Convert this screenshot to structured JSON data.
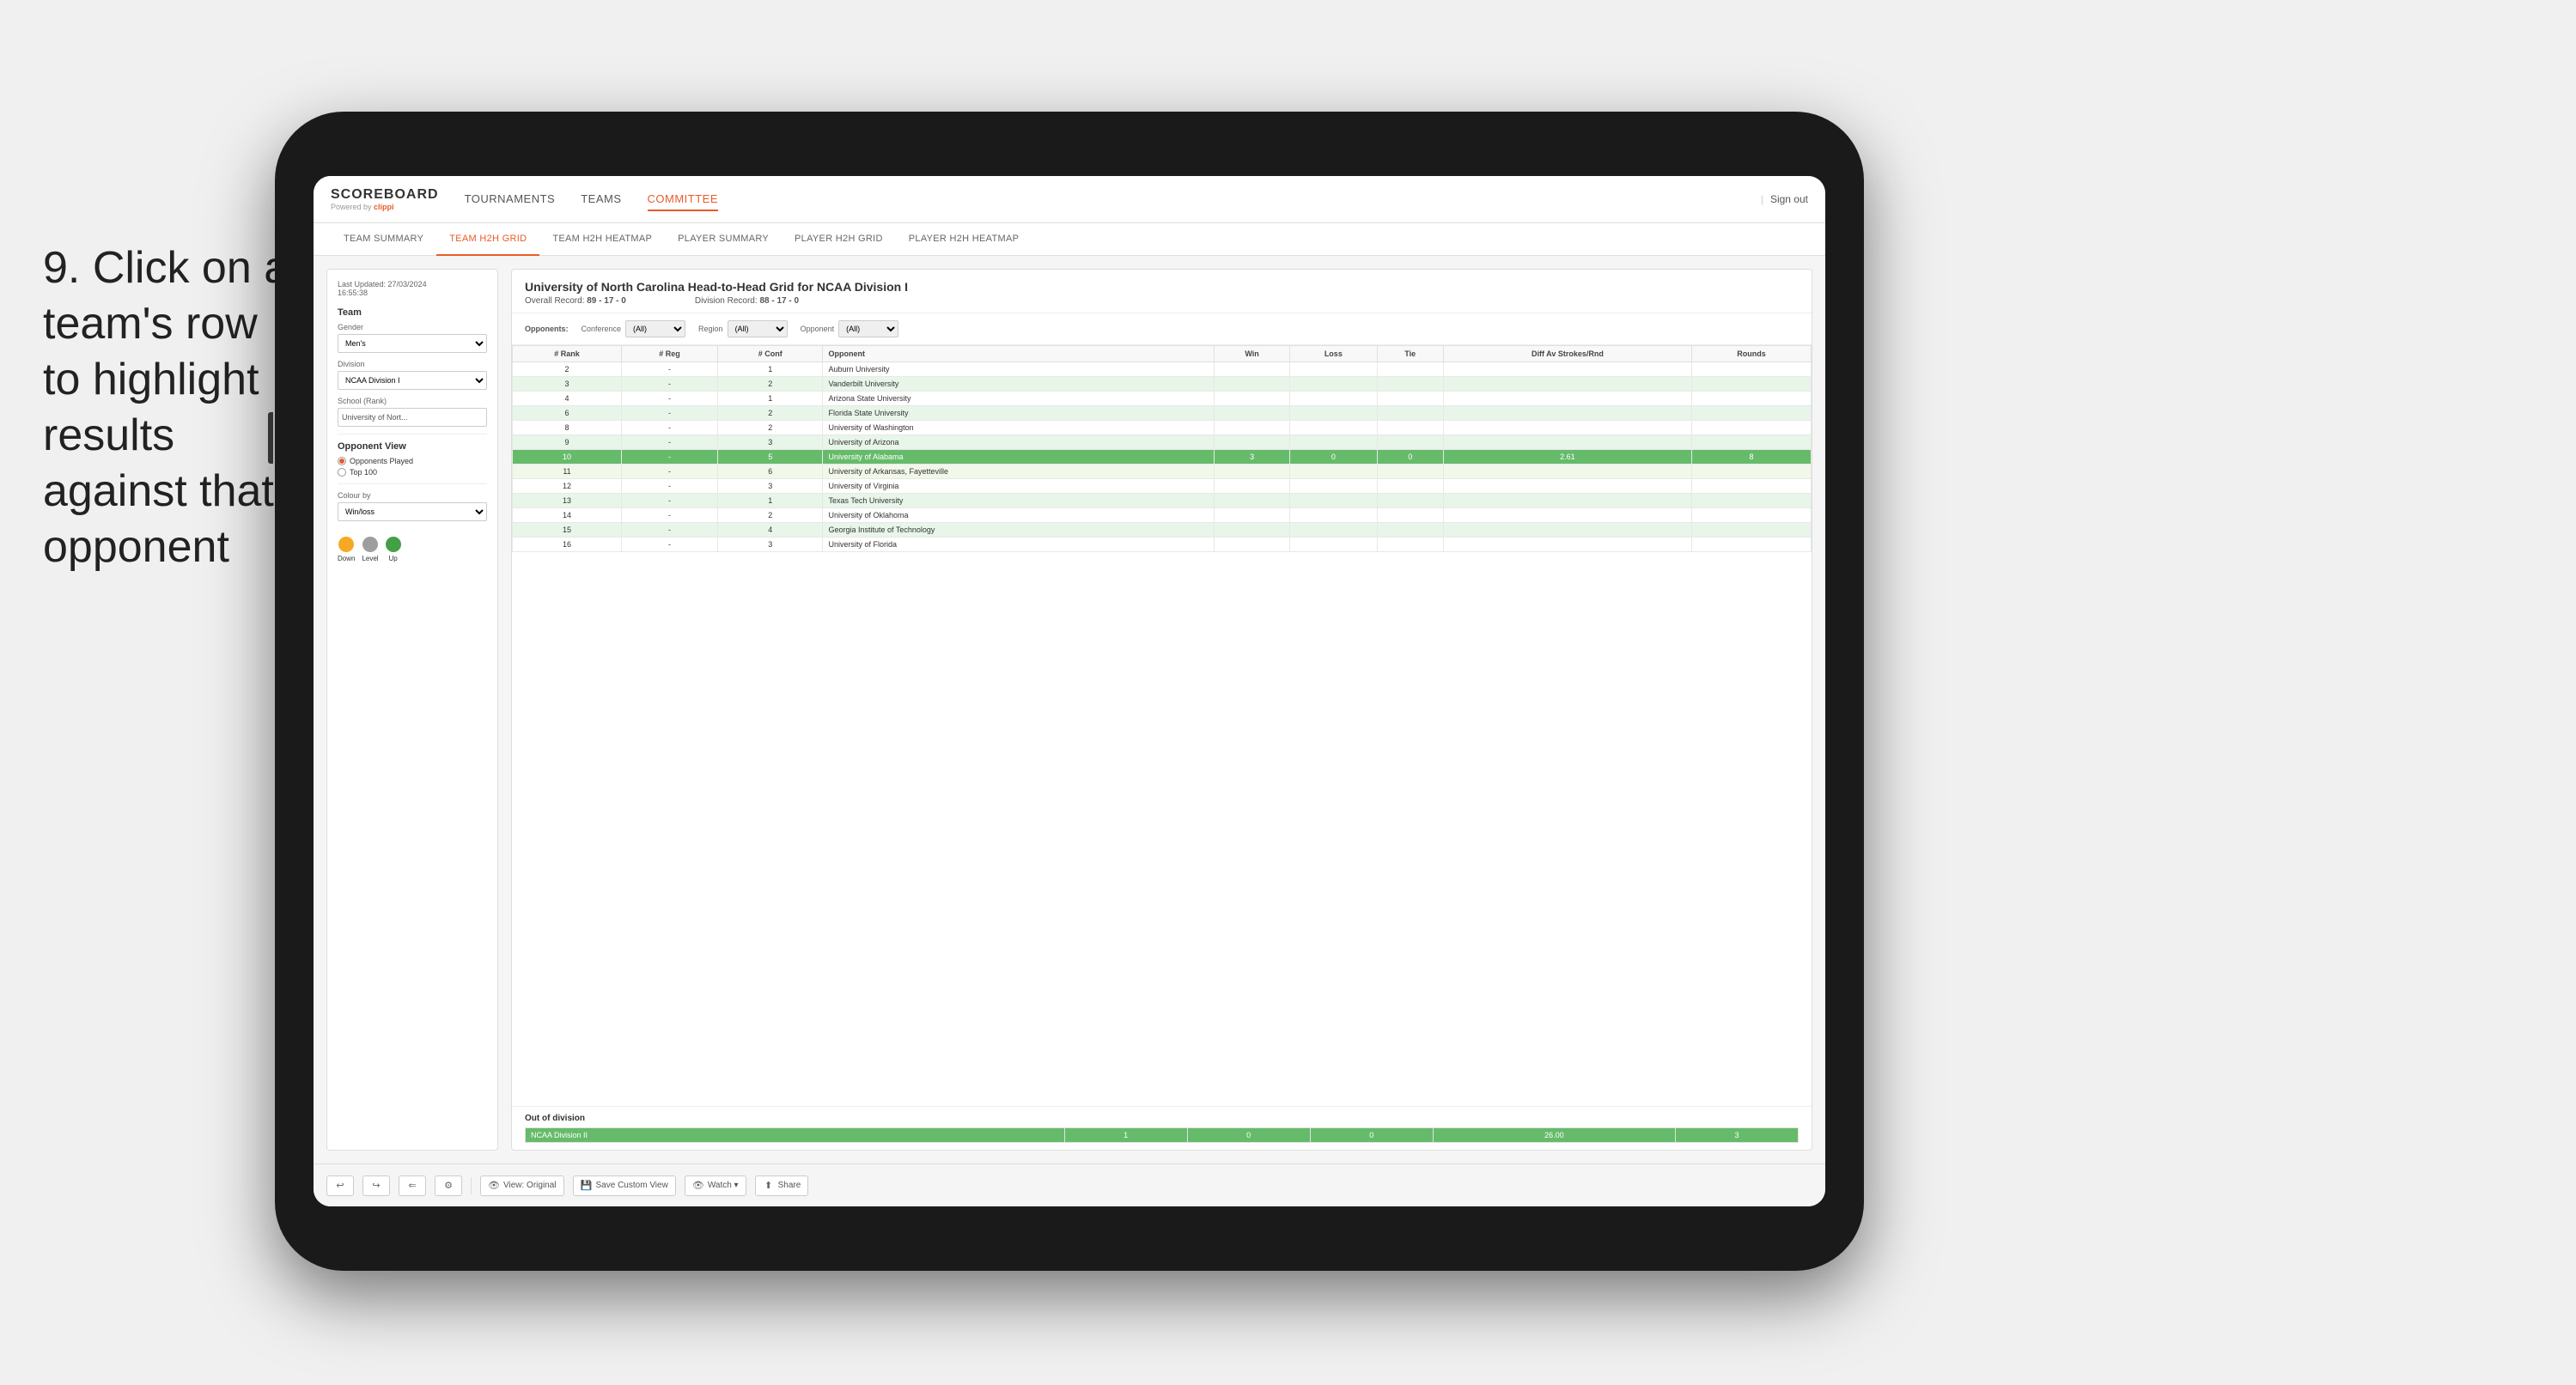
{
  "instruction": {
    "number": "9.",
    "text": "Click on a team's row to highlight results against that opponent"
  },
  "nav": {
    "brand": "SCOREBOARD",
    "powered_by": "Powered by",
    "powered_by_brand": "clippi",
    "items": [
      "TOURNAMENTS",
      "TEAMS",
      "COMMITTEE"
    ],
    "sign_out": "Sign out"
  },
  "sub_nav": {
    "items": [
      "TEAM SUMMARY",
      "TEAM H2H GRID",
      "TEAM H2H HEATMAP",
      "PLAYER SUMMARY",
      "PLAYER H2H GRID",
      "PLAYER H2H HEATMAP"
    ],
    "active": "TEAM H2H GRID"
  },
  "left_panel": {
    "last_updated_label": "Last Updated: 27/03/2024",
    "last_updated_time": "16:55:38",
    "team_label": "Team",
    "gender_label": "Gender",
    "gender_value": "Men's",
    "division_label": "Division",
    "division_value": "NCAA Division I",
    "school_label": "School (Rank)",
    "school_value": "University of Nort...",
    "opponent_view_label": "Opponent View",
    "opponents_played": "Opponents Played",
    "top_100": "Top 100",
    "colour_by_label": "Colour by",
    "colour_by_value": "Win/loss",
    "legend": {
      "down_label": "Down",
      "level_label": "Level",
      "up_label": "Up",
      "down_color": "#f9a825",
      "level_color": "#9e9e9e",
      "up_color": "#43a047"
    }
  },
  "grid": {
    "title": "University of North Carolina Head-to-Head Grid for NCAA Division I",
    "overall_record_label": "Overall Record:",
    "overall_record": "89 - 17 - 0",
    "division_record_label": "Division Record:",
    "division_record": "88 - 17 - 0",
    "conference_label": "Conference",
    "conference_value": "(All)",
    "region_label": "Region",
    "region_value": "(All)",
    "opponent_label": "Opponent",
    "opponent_value": "(All)",
    "opponents_label": "Opponents:",
    "columns": {
      "rank": "#\nRank",
      "reg": "#\nReg",
      "conf": "#\nConf",
      "opponent": "Opponent",
      "win": "Win",
      "loss": "Loss",
      "tie": "Tie",
      "diff_av": "Diff Av\nStrokes/Rnd",
      "rounds": "Rounds"
    },
    "rows": [
      {
        "rank": "2",
        "reg": "-",
        "conf": "1",
        "opponent": "Auburn University",
        "win": "",
        "loss": "",
        "tie": "",
        "diff_av": "",
        "rounds": "",
        "style": "normal"
      },
      {
        "rank": "3",
        "reg": "-",
        "conf": "2",
        "opponent": "Vanderbilt University",
        "win": "",
        "loss": "",
        "tie": "",
        "diff_av": "",
        "rounds": "",
        "style": "light-green"
      },
      {
        "rank": "4",
        "reg": "-",
        "conf": "1",
        "opponent": "Arizona State University",
        "win": "",
        "loss": "",
        "tie": "",
        "diff_av": "",
        "rounds": "",
        "style": "normal"
      },
      {
        "rank": "6",
        "reg": "-",
        "conf": "2",
        "opponent": "Florida State University",
        "win": "",
        "loss": "",
        "tie": "",
        "diff_av": "",
        "rounds": "",
        "style": "light-green"
      },
      {
        "rank": "8",
        "reg": "-",
        "conf": "2",
        "opponent": "University of Washington",
        "win": "",
        "loss": "",
        "tie": "",
        "diff_av": "",
        "rounds": "",
        "style": "normal"
      },
      {
        "rank": "9",
        "reg": "-",
        "conf": "3",
        "opponent": "University of Arizona",
        "win": "",
        "loss": "",
        "tie": "",
        "diff_av": "",
        "rounds": "",
        "style": "light-green"
      },
      {
        "rank": "10",
        "reg": "-",
        "conf": "5",
        "opponent": "University of Alabama",
        "win": "3",
        "loss": "0",
        "tie": "0",
        "diff_av": "2.61",
        "rounds": "8",
        "style": "highlighted"
      },
      {
        "rank": "11",
        "reg": "-",
        "conf": "6",
        "opponent": "University of Arkansas, Fayetteville",
        "win": "",
        "loss": "",
        "tie": "",
        "diff_av": "",
        "rounds": "",
        "style": "very-light-green"
      },
      {
        "rank": "12",
        "reg": "-",
        "conf": "3",
        "opponent": "University of Virginia",
        "win": "",
        "loss": "",
        "tie": "",
        "diff_av": "",
        "rounds": "",
        "style": "normal"
      },
      {
        "rank": "13",
        "reg": "-",
        "conf": "1",
        "opponent": "Texas Tech University",
        "win": "",
        "loss": "",
        "tie": "",
        "diff_av": "",
        "rounds": "",
        "style": "light-green"
      },
      {
        "rank": "14",
        "reg": "-",
        "conf": "2",
        "opponent": "University of Oklahoma",
        "win": "",
        "loss": "",
        "tie": "",
        "diff_av": "",
        "rounds": "",
        "style": "normal"
      },
      {
        "rank": "15",
        "reg": "-",
        "conf": "4",
        "opponent": "Georgia Institute of Technology",
        "win": "",
        "loss": "",
        "tie": "",
        "diff_av": "",
        "rounds": "",
        "style": "light-green"
      },
      {
        "rank": "16",
        "reg": "-",
        "conf": "3",
        "opponent": "University of Florida",
        "win": "",
        "loss": "",
        "tie": "",
        "diff_av": "",
        "rounds": "",
        "style": "normal"
      }
    ],
    "out_of_division": {
      "label": "Out of division",
      "row": {
        "label": "NCAA Division II",
        "win": "1",
        "loss": "0",
        "tie": "0",
        "diff_av": "26.00",
        "rounds": "3",
        "style": "green"
      }
    }
  },
  "toolbar": {
    "undo": "↩",
    "redo": "↪",
    "buttons": [
      "View: Original",
      "Save Custom View",
      "Watch ▾",
      "Share"
    ]
  }
}
